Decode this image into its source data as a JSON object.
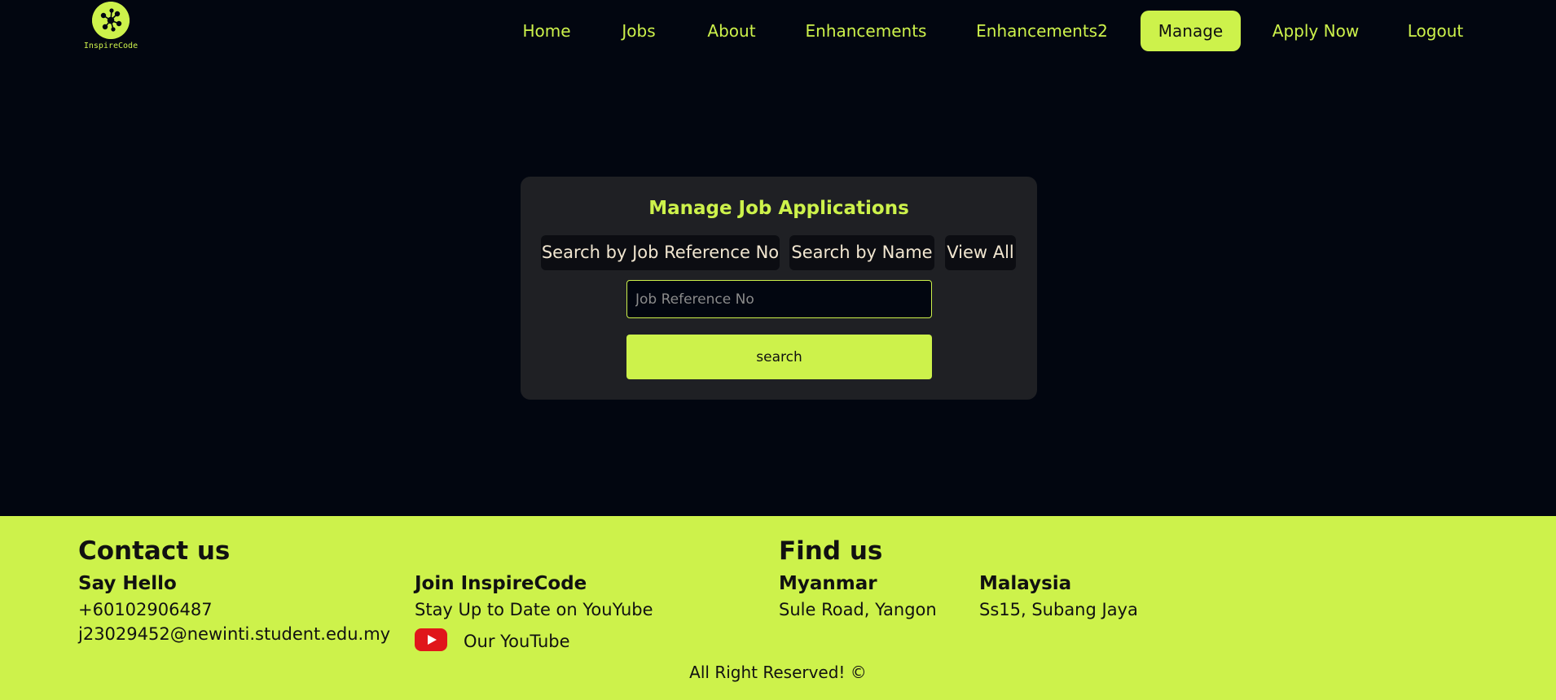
{
  "brand": {
    "logo_text": "InspireCode"
  },
  "nav": {
    "items": [
      {
        "label": "Home"
      },
      {
        "label": "Jobs"
      },
      {
        "label": "About"
      },
      {
        "label": "Enhancements"
      },
      {
        "label": "Enhancements2"
      },
      {
        "label": "Manage",
        "active": true
      },
      {
        "label": "Apply Now"
      },
      {
        "label": "Logout"
      }
    ]
  },
  "manage": {
    "title": "Manage Job Applications",
    "tabs": [
      {
        "label": "Search by Job Reference No"
      },
      {
        "label": "Search by Name"
      },
      {
        "label": "View All"
      }
    ],
    "input": {
      "placeholder": "Job Reference No",
      "value": ""
    },
    "search_button": "search"
  },
  "footer": {
    "contact_heading": "Contact us",
    "say_hello": {
      "title": "Say Hello",
      "phone": "+60102906487",
      "email": "j23029452@newinti.student.edu.my"
    },
    "join": {
      "title": "Join InspireCode",
      "subtitle": "Stay Up to Date on YouYube",
      "youtube_label": "Our YouTube",
      "icon": "youtube-icon"
    },
    "find_heading": "Find us",
    "locations": [
      {
        "country": "Myanmar",
        "address": "Sule Road, Yangon"
      },
      {
        "country": "Malaysia",
        "address": "Ss15, Subang Jaya"
      }
    ],
    "copyright": "All Right Reserved! ©"
  },
  "colors": {
    "background": "#020610",
    "accent": "#cdf24b",
    "card": "#1f2024",
    "youtube_red": "#e0161b"
  }
}
